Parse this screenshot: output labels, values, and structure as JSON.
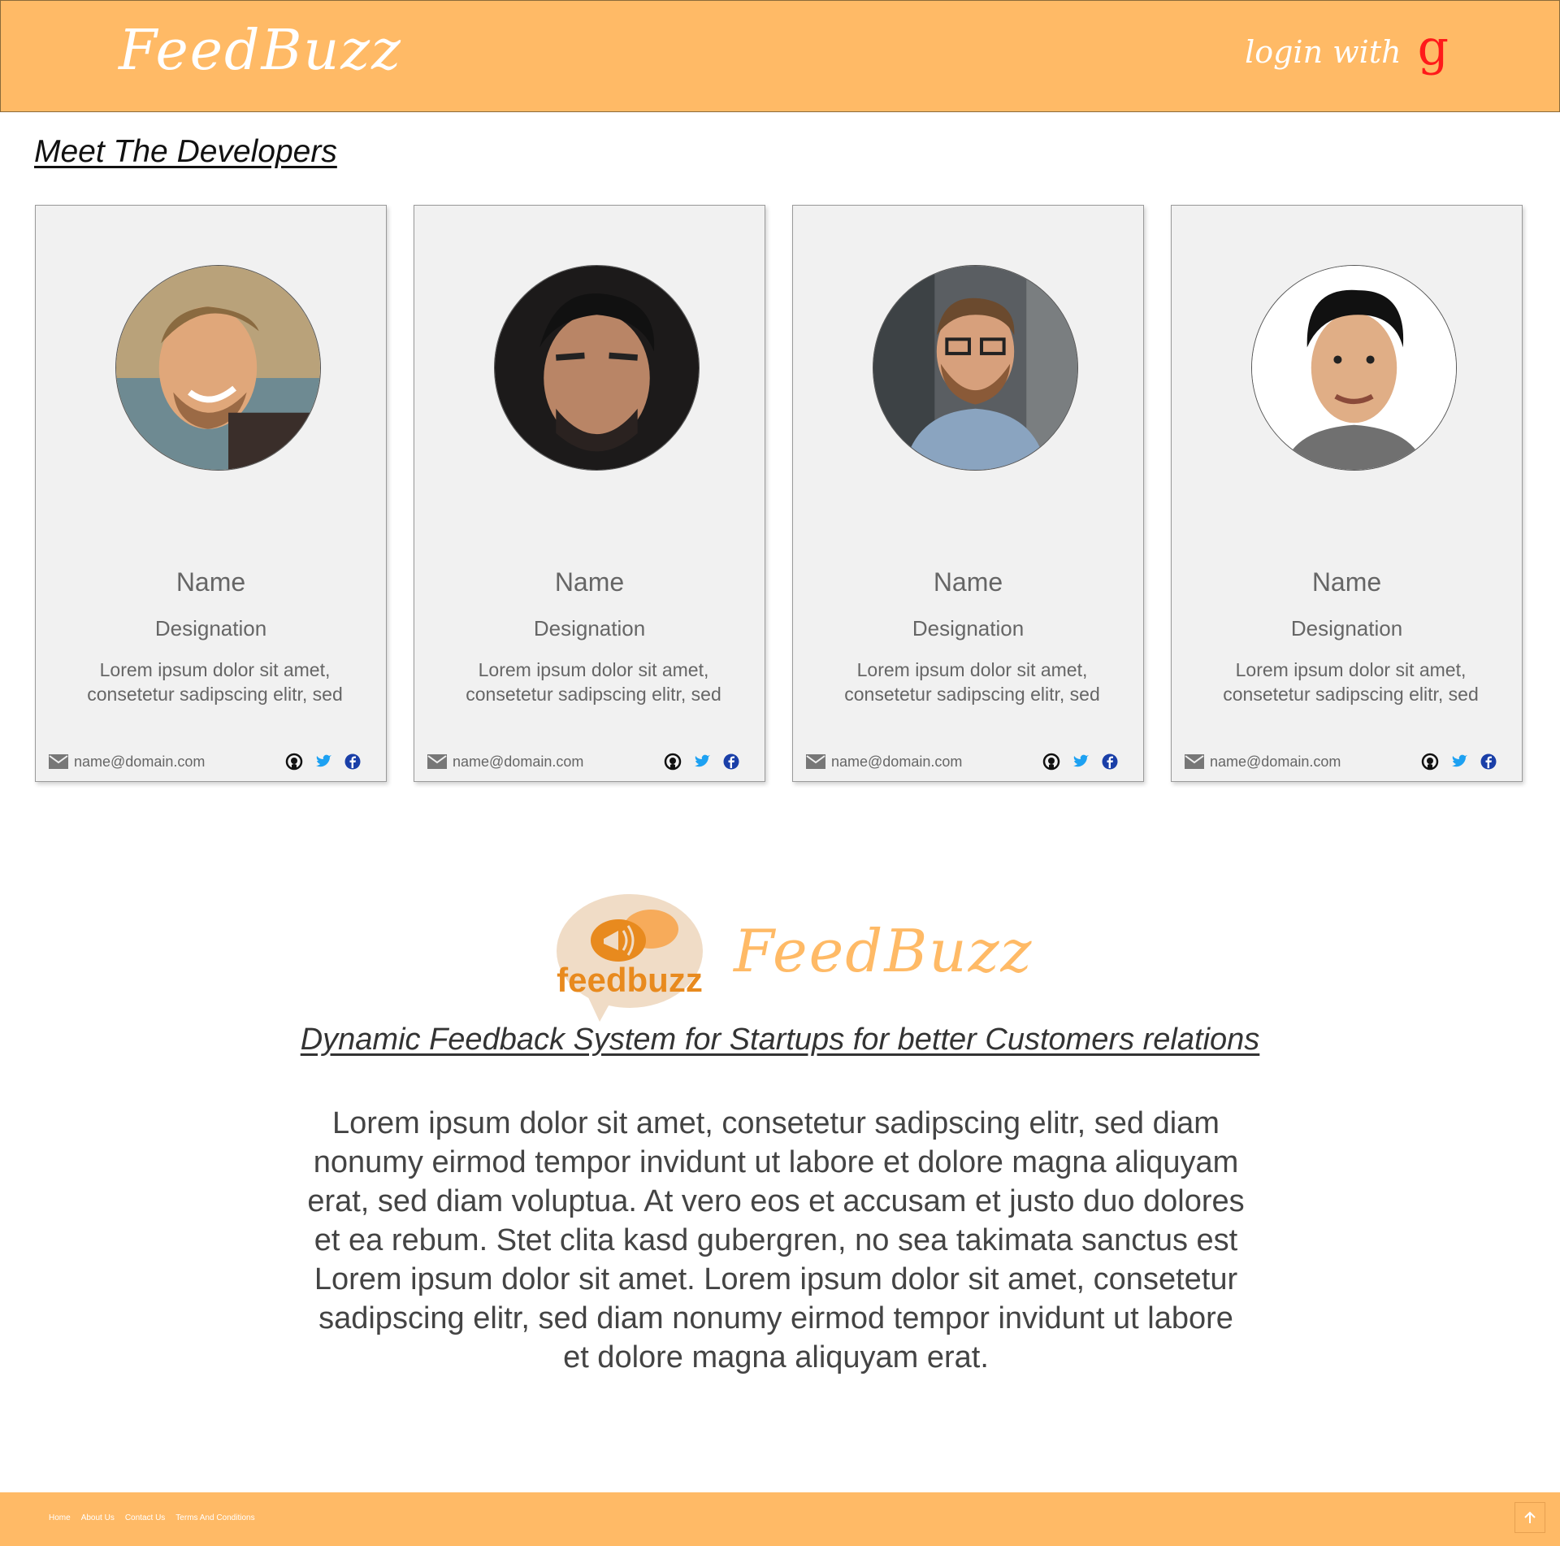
{
  "header": {
    "brand": "FeedBuzz",
    "login_label": "login with",
    "login_icon": "g"
  },
  "section_title": "Meet The Developers",
  "cards": [
    {
      "name": "Name",
      "designation": "Designation",
      "description": "Lorem ipsum dolor sit amet, consetetur sadipscing elitr, sed",
      "email": "name@domain.com",
      "avatar": "developer-photo-1"
    },
    {
      "name": "Name",
      "designation": "Designation",
      "description": "Lorem ipsum dolor sit amet, consetetur sadipscing elitr, sed",
      "email": "name@domain.com",
      "avatar": "developer-photo-2"
    },
    {
      "name": "Name",
      "designation": "Designation",
      "description": "Lorem ipsum dolor sit amet, consetetur sadipscing elitr, sed",
      "email": "name@domain.com",
      "avatar": "developer-photo-3"
    },
    {
      "name": "Name",
      "designation": "Designation",
      "description": "Lorem ipsum dolor sit amet, consetetur sadipscing elitr, sed",
      "email": "name@domain.com",
      "avatar": "developer-photo-4"
    }
  ],
  "about": {
    "logo_text": "feedbuzz",
    "brand": "FeedBuzz",
    "tagline": "Dynamic Feedback System for Startups for better Customers relations",
    "text": "Lorem ipsum dolor sit amet, consetetur sadipscing elitr, sed diam nonumy eirmod tempor invidunt ut labore et dolore magna aliquyam erat, sed diam voluptua. At vero eos et accusam et justo duo dolores et ea rebum. Stet clita kasd gubergren, no sea takimata sanctus est Lorem ipsum dolor sit amet. Lorem ipsum dolor sit amet, consetetur sadipscing elitr, sed diam nonumy eirmod tempor invidunt ut labore et dolore magna aliquyam erat."
  },
  "footer": {
    "links": [
      "Home",
      "About Us",
      "Contact Us",
      "Terms And Conditions"
    ]
  },
  "colors": {
    "accent": "#ffba66",
    "google_red": "#ff1a1a",
    "twitter": "#1da1f2",
    "facebook": "#1a3fa8",
    "card_bg": "#f1f1f1"
  }
}
